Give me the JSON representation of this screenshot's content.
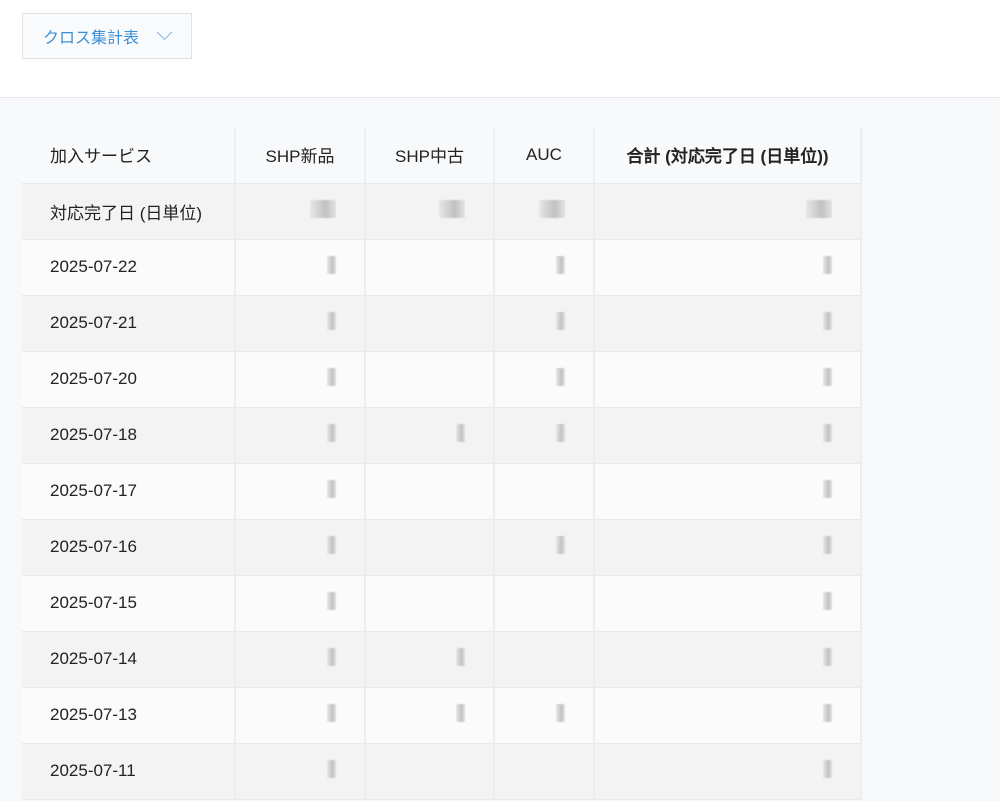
{
  "toolbar": {
    "view_label": "クロス集計表",
    "view_icon": "chevron-down-icon"
  },
  "table": {
    "headers": [
      "加入サービス",
      "SHP新品",
      "SHP中古",
      "AUC",
      "合計 (対応完了日 (日単位))"
    ],
    "summary_row": {
      "label": "対応完了日 (日単位)",
      "cells": [
        true,
        true,
        true,
        true
      ]
    },
    "rows": [
      {
        "date": "2025-07-22",
        "cells": [
          true,
          false,
          true,
          true
        ]
      },
      {
        "date": "2025-07-21",
        "cells": [
          true,
          false,
          true,
          true
        ]
      },
      {
        "date": "2025-07-20",
        "cells": [
          true,
          false,
          true,
          true
        ]
      },
      {
        "date": "2025-07-18",
        "cells": [
          true,
          true,
          true,
          true
        ]
      },
      {
        "date": "2025-07-17",
        "cells": [
          true,
          false,
          false,
          true
        ]
      },
      {
        "date": "2025-07-16",
        "cells": [
          true,
          false,
          true,
          true
        ]
      },
      {
        "date": "2025-07-15",
        "cells": [
          true,
          false,
          false,
          true
        ]
      },
      {
        "date": "2025-07-14",
        "cells": [
          true,
          true,
          false,
          true
        ]
      },
      {
        "date": "2025-07-13",
        "cells": [
          true,
          true,
          true,
          true
        ]
      },
      {
        "date": "2025-07-11",
        "cells": [
          true,
          false,
          false,
          true
        ]
      }
    ]
  }
}
